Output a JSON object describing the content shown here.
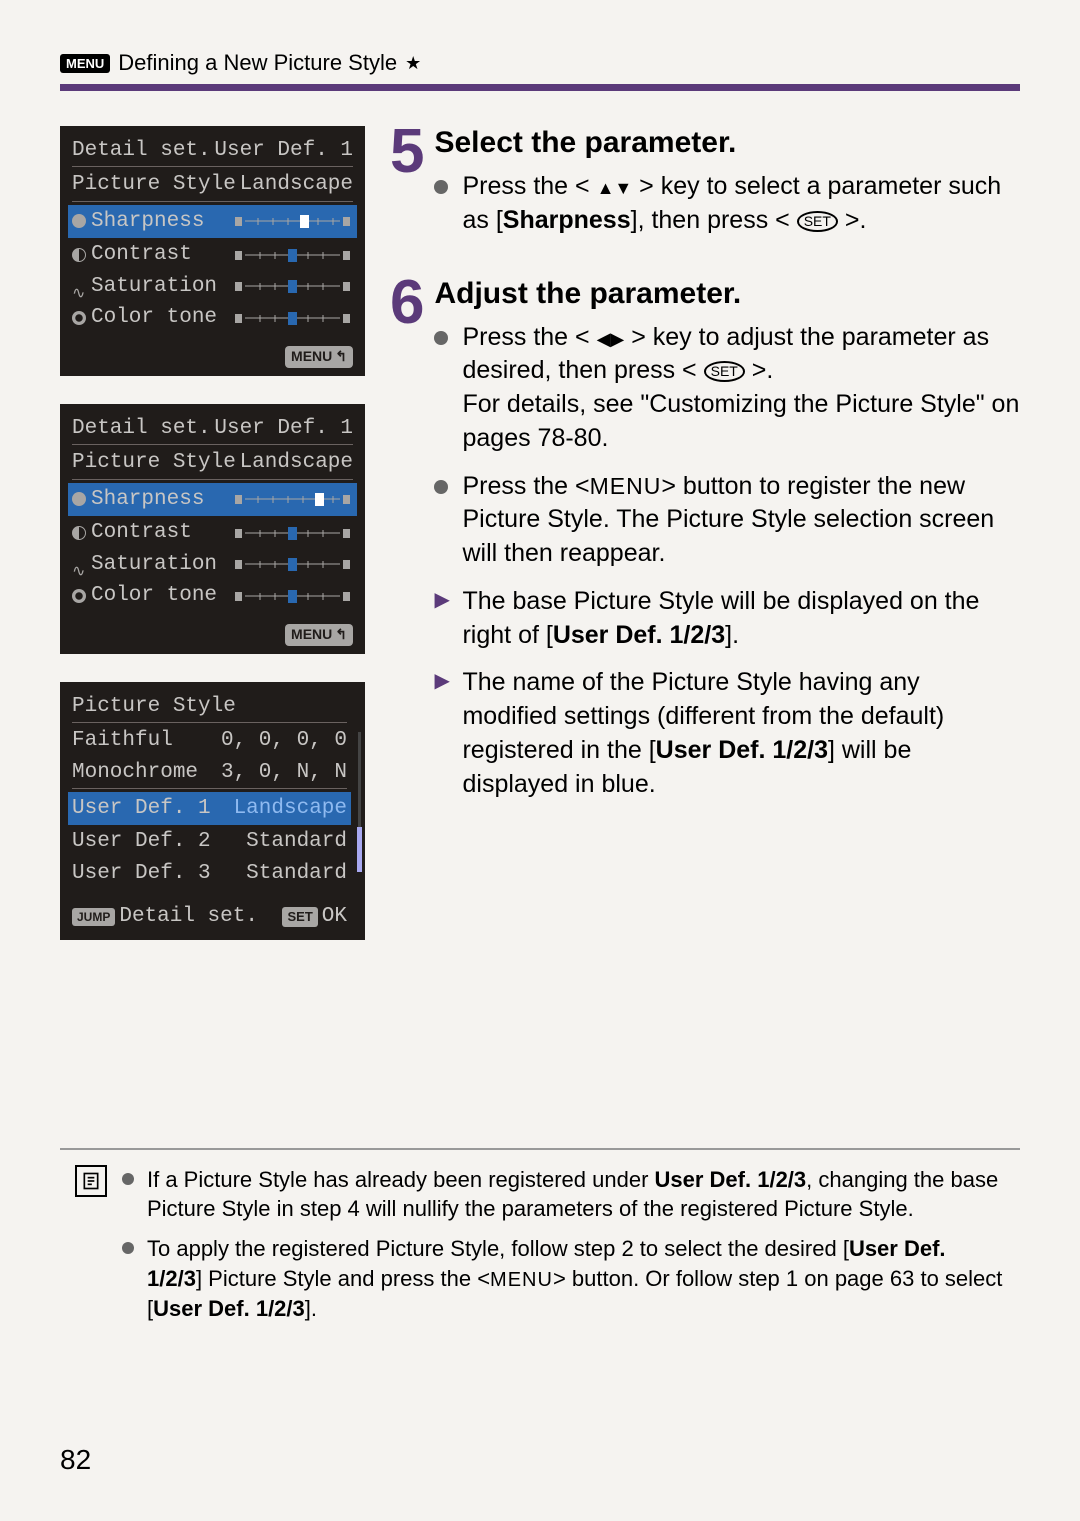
{
  "header": {
    "menu_badge": "MENU",
    "title": "Defining a New Picture Style",
    "star": "★"
  },
  "screens": {
    "screen1": {
      "title": "Detail set.",
      "user_def": "User Def. 1",
      "picstyle_label": "Picture Style",
      "picstyle_value": "Landscape",
      "params": {
        "sharpness": "Sharpness",
        "contrast": "Contrast",
        "saturation": "Saturation",
        "colortone": "Color tone"
      },
      "footer_btn": "MENU"
    },
    "screen2": {
      "title": "Detail set.",
      "user_def": "User Def. 1",
      "picstyle_label": "Picture Style",
      "picstyle_value": "Landscape",
      "params": {
        "sharpness": "Sharpness",
        "contrast": "Contrast",
        "saturation": "Saturation",
        "colortone": "Color tone"
      },
      "footer_btn": "MENU"
    },
    "screen3": {
      "title": "Picture Style",
      "rows": [
        {
          "name": "Faithful",
          "val": "0, 0, 0, 0"
        },
        {
          "name": "Monochrome",
          "val": "3, 0, N, N"
        },
        {
          "name": "User Def. 1",
          "val": "Landscape"
        },
        {
          "name": "User Def. 2",
          "val": "Standard"
        },
        {
          "name": "User Def. 3",
          "val": "Standard"
        }
      ],
      "jump": "JUMP",
      "detail": "Detail set.",
      "set": "SET",
      "ok": "OK"
    }
  },
  "steps": {
    "s5": {
      "num": "5",
      "title": "Select the parameter.",
      "b1a": "Press the < ",
      "b1b": " > key to select a parameter such as [",
      "b1c": "Sharpness",
      "b1d": "], then press < ",
      "b1e": " >."
    },
    "s6": {
      "num": "6",
      "title": "Adjust the parameter.",
      "b1a": "Press the < ",
      "b1b": " > key to adjust the parameter as desired, then press < ",
      "b1c": " >.",
      "b1d": "For details, see \"Customizing the Picture Style\" on pages 78-80.",
      "b2a": "Press the <",
      "b2b": "MENU",
      "b2c": "> button to register the new Picture Style. The Picture Style selection screen will then reappear.",
      "t1a": "The base Picture Style will be displayed on the right of [",
      "t1b": "User Def. 1/2/3",
      "t1c": "].",
      "t2a": "The name of the Picture Style having any modified settings (different from the default) registered in the [",
      "t2b": "User Def. 1/2/3",
      "t2c": "] will be displayed in blue."
    }
  },
  "notes": {
    "n1a": "If a Picture Style has already been registered under ",
    "n1b": "User Def. 1/2/3",
    "n1c": ", changing the base Picture Style in step 4 will nullify the parameters of the registered Picture Style.",
    "n2a": "To apply the registered Picture Style, follow step 2 to select the desired [",
    "n2b": "User Def. 1/2/3",
    "n2c": "] Picture Style and press the <",
    "n2d": "MENU",
    "n2e": "> button. Or follow step 1 on page 63 to select [",
    "n2f": "User Def. 1/2/3",
    "n2g": "]."
  },
  "set_label": "SET",
  "page_num": "82"
}
